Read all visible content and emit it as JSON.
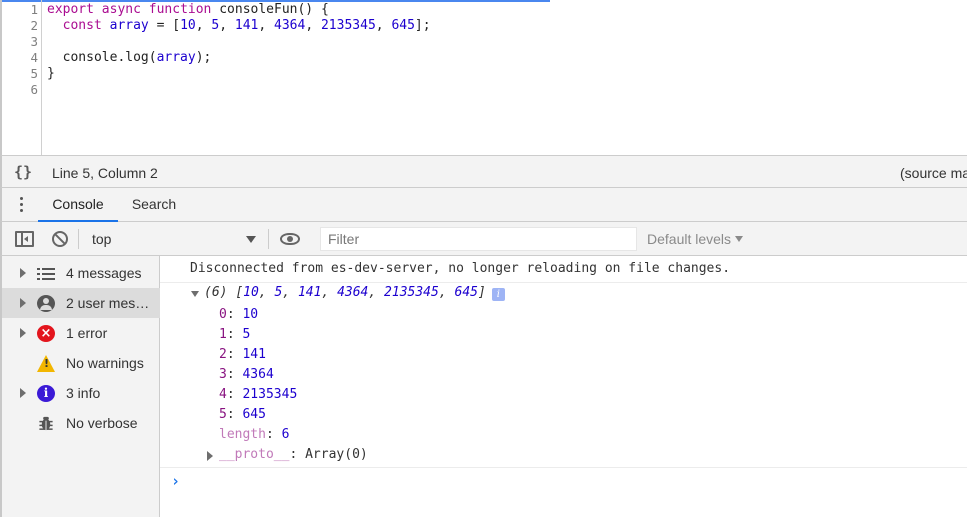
{
  "editor": {
    "line_numbers": [
      "1",
      "2",
      "3",
      "4",
      "5",
      "6"
    ],
    "lines": [
      [
        {
          "t": "export",
          "c": "kw"
        },
        {
          "t": " "
        },
        {
          "t": "async",
          "c": "kw"
        },
        {
          "t": " "
        },
        {
          "t": "function",
          "c": "kw"
        },
        {
          "t": " consoleFun() {",
          "c": "def"
        }
      ],
      [
        {
          "t": "  "
        },
        {
          "t": "const",
          "c": "kw"
        },
        {
          "t": " "
        },
        {
          "t": "array",
          "c": "var"
        },
        {
          "t": " = [",
          "c": "def"
        },
        {
          "t": "10",
          "c": "num"
        },
        {
          "t": ", ",
          "c": "def"
        },
        {
          "t": "5",
          "c": "num"
        },
        {
          "t": ", ",
          "c": "def"
        },
        {
          "t": "141",
          "c": "num"
        },
        {
          "t": ", ",
          "c": "def"
        },
        {
          "t": "4364",
          "c": "num"
        },
        {
          "t": ", ",
          "c": "def"
        },
        {
          "t": "2135345",
          "c": "num"
        },
        {
          "t": ", ",
          "c": "def"
        },
        {
          "t": "645",
          "c": "num"
        },
        {
          "t": "];",
          "c": "def"
        }
      ],
      [],
      [
        {
          "t": "  console.log(",
          "c": "def"
        },
        {
          "t": "array",
          "c": "var"
        },
        {
          "t": ");",
          "c": "def"
        }
      ],
      [
        {
          "t": "}",
          "c": "def"
        }
      ],
      []
    ]
  },
  "statusbar": {
    "format_icon": "{}",
    "position": "Line 5, Column 2",
    "source_map": "(source ma"
  },
  "drawer": {
    "menu_icon": "kebab-menu-icon",
    "tabs": [
      {
        "label": "Console",
        "active": true
      },
      {
        "label": "Search",
        "active": false
      }
    ]
  },
  "toolbar": {
    "context": "top",
    "filter_placeholder": "Filter",
    "levels": "Default levels"
  },
  "sidebar": {
    "items": [
      {
        "label": "4 messages",
        "icon": "list-icon",
        "expandable": true
      },
      {
        "label": "2 user mes…",
        "icon": "user-icon",
        "expandable": true,
        "selected": true
      },
      {
        "label": "1 error",
        "icon": "error-icon",
        "expandable": true
      },
      {
        "label": "No warnings",
        "icon": "warning-icon",
        "expandable": false
      },
      {
        "label": "3 info",
        "icon": "info-icon",
        "expandable": true
      },
      {
        "label": "No verbose",
        "icon": "bug-icon",
        "expandable": false
      }
    ],
    "error_glyph": "×",
    "warning_glyph": "!",
    "info_glyph": "i"
  },
  "console": {
    "system_message": "Disconnected from es-dev-server, no longer reloading on file changes.",
    "array_preview": {
      "count": "(6)",
      "open": "[",
      "values": [
        "10",
        "5",
        "141",
        "4364",
        "2135345",
        "645"
      ],
      "close": "]",
      "badge": "i"
    },
    "entries": [
      {
        "key": "0",
        "value": "10"
      },
      {
        "key": "1",
        "value": "5"
      },
      {
        "key": "2",
        "value": "141"
      },
      {
        "key": "3",
        "value": "4364"
      },
      {
        "key": "4",
        "value": "2135345"
      },
      {
        "key": "5",
        "value": "645"
      }
    ],
    "length": {
      "key": "length",
      "value": "6"
    },
    "proto": {
      "key": "__proto__",
      "value": "Array(0)"
    },
    "prompt": "›"
  }
}
